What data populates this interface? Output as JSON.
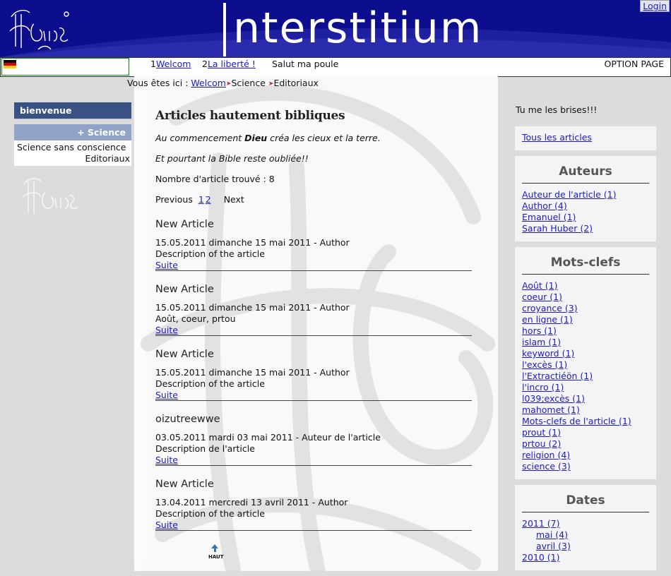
{
  "header": {
    "site_title": "nterstitium",
    "login_label": "Login"
  },
  "nav": {
    "items": [
      {
        "num": "1",
        "label": "Welcom"
      },
      {
        "num": "2",
        "label": "La liberté !"
      }
    ],
    "extra": "Salut ma poule",
    "option_page": "OPTION PAGE"
  },
  "breadcrumb": {
    "prefix": "Vous êtes ici :",
    "home": "Welcom",
    "level1": "Science",
    "level2": "Editoriaux"
  },
  "left_menu": {
    "bienvenue": "bienvenue",
    "science": "+ Science",
    "submenu": [
      "Science sans conscience",
      "Editoriaux"
    ]
  },
  "main": {
    "heading": "Articles hautement bibliques",
    "intro1_pre": "Au commencement ",
    "intro1_bold": "Dieu",
    "intro1_post": " créa les cieux et la terre.",
    "intro2": "Et pourtant la Bible reste oubliée!!",
    "count": "Nombre d'article trouvé : 8",
    "pager": {
      "previous": "Previous",
      "pages": [
        "1",
        "2"
      ],
      "next": "Next"
    },
    "articles": [
      {
        "title": "New Article",
        "meta": "15.05.2011 dimanche 15 mai 2011 - Author",
        "desc": "Description of the article",
        "more": "Suite"
      },
      {
        "title": "New Article",
        "meta": "15.05.2011 dimanche 15 mai 2011 - Author",
        "desc": "Août, coeur, prtou",
        "more": "Suite"
      },
      {
        "title": "New Article",
        "meta": "15.05.2011 dimanche 15 mai 2011 - Author",
        "desc": "Description of the article",
        "more": "Suite"
      },
      {
        "title": "oizutreewwe",
        "meta": "03.05.2011 mardi 03 mai 2011 - Auteur de l'article",
        "desc": "Description de l'article",
        "more": "Suite"
      },
      {
        "title": "New Article",
        "meta": "13.04.2011 mercredi 13 avril 2011 - Author",
        "desc": "Description of the article",
        "more": "Suite"
      }
    ],
    "haut": "HAUT"
  },
  "right": {
    "tagline": "Tu me les brises!!!",
    "all_articles": "Tous les articles",
    "authors_title": "Auteurs",
    "authors": [
      "Auteur de l'article (1)",
      "Author (4)",
      "Emanuel (1)",
      "Sarah Huber (2)"
    ],
    "keywords_title": "Mots-clefs",
    "keywords": [
      "Août (1)",
      "coeur (1)",
      "croyance (3)",
      "en ligne (1)",
      "hors (1)",
      "islam (1)",
      "keyword (1)",
      "l'excès (1)",
      "l'Extractiéön (1)",
      "l'incro (1)",
      "l039;excès (1)",
      "mahomet (1)",
      "Mots-clefs de l'article (1)",
      "prout (1)",
      "prtou (2)",
      "religion (4)",
      "science (3)"
    ],
    "dates_title": "Dates",
    "dates": [
      {
        "label": "2011 (7)",
        "sub": false
      },
      {
        "label": "mai (4)",
        "sub": true
      },
      {
        "label": "avril (3)",
        "sub": true
      },
      {
        "label": "2010 (1)",
        "sub": false
      }
    ]
  },
  "colors": {
    "header_bg": "#0d0e8e",
    "menu_dark": "#3a5183",
    "menu_light": "#91a3c6",
    "link": "#1a1ad0"
  }
}
